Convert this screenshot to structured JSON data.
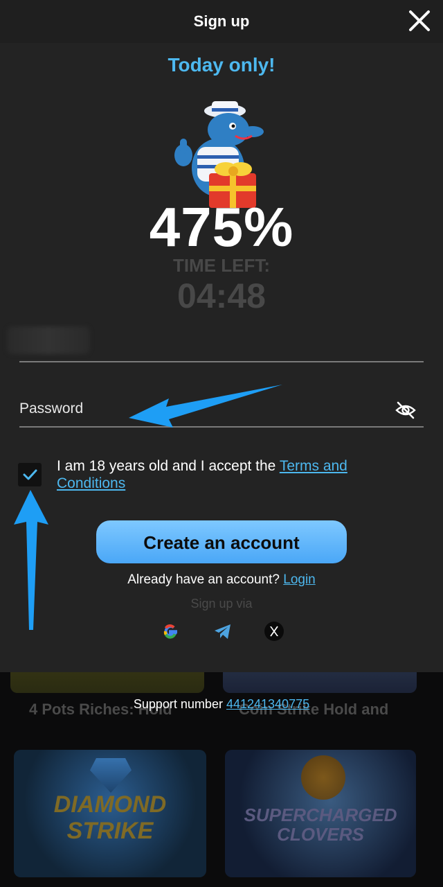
{
  "header": {
    "title": "Sign up",
    "close_icon": "close-icon"
  },
  "promo": {
    "headline": "Today only!",
    "bonus_percent": "475%",
    "timer_label": "TIME LEFT:",
    "timer_value": "04:48",
    "mascot_icon": "dolphin-sailor-gift-icon"
  },
  "form": {
    "password_placeholder": "Password",
    "password_value": "",
    "eye_icon": "eye-slash-icon",
    "consent_text": "I am 18 years old and I accept the ",
    "terms_link": "Terms and Conditions",
    "checkbox_checked": true,
    "create_button": "Create an account",
    "login_prompt": "Already have an account?",
    "login_link": "Login",
    "sign_up_via": "Sign up via",
    "social_icons": [
      "google-icon",
      "telegram-icon",
      "x-icon"
    ]
  },
  "background": {
    "game_titles": [
      "4 Pots Riches: Hold",
      "Coin Strike Hold and"
    ],
    "game_logos": [
      "DIAMOND STRIKE",
      "SUPERCHARGED CLOVERS"
    ]
  },
  "support": {
    "label": "Support number",
    "number": "441241340775"
  },
  "colors": {
    "accent": "#4db8ef",
    "modal_bg": "#232323",
    "button_gradient_top": "#7ec8ff",
    "button_gradient_bottom": "#4aa7f7",
    "annotation_arrow": "#1e9ef5"
  }
}
